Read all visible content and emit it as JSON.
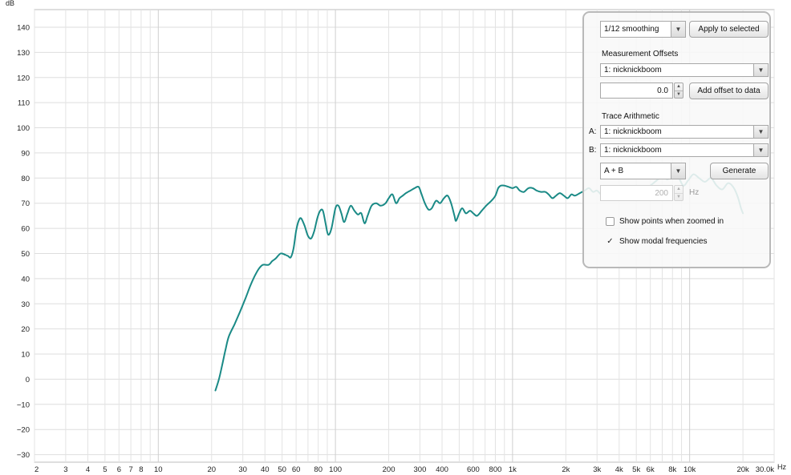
{
  "chart_data": {
    "type": "line",
    "ylabel": "dB",
    "xunit": "Hz",
    "xscale": "log",
    "xlim": [
      2,
      30000
    ],
    "ylim": [
      -33,
      147
    ],
    "y_ticks": [
      140,
      130,
      120,
      110,
      100,
      90,
      80,
      70,
      60,
      50,
      40,
      30,
      20,
      10,
      0,
      -10,
      -20,
      -30
    ],
    "x_tick_labels": [
      {
        "v": 2,
        "label": "2"
      },
      {
        "v": 3,
        "label": "3"
      },
      {
        "v": 4,
        "label": "4"
      },
      {
        "v": 5,
        "label": "5"
      },
      {
        "v": 6,
        "label": "6"
      },
      {
        "v": 7,
        "label": "7"
      },
      {
        "v": 8,
        "label": "8"
      },
      {
        "v": 10,
        "label": "10"
      },
      {
        "v": 20,
        "label": "20"
      },
      {
        "v": 30,
        "label": "30"
      },
      {
        "v": 40,
        "label": "40"
      },
      {
        "v": 50,
        "label": "50"
      },
      {
        "v": 60,
        "label": "60"
      },
      {
        "v": 80,
        "label": "80"
      },
      {
        "v": 100,
        "label": "100"
      },
      {
        "v": 200,
        "label": "200"
      },
      {
        "v": 300,
        "label": "300"
      },
      {
        "v": 400,
        "label": "400"
      },
      {
        "v": 600,
        "label": "600"
      },
      {
        "v": 800,
        "label": "800"
      },
      {
        "v": 1000,
        "label": "1k"
      },
      {
        "v": 2000,
        "label": "2k"
      },
      {
        "v": 3000,
        "label": "3k"
      },
      {
        "v": 4000,
        "label": "4k"
      },
      {
        "v": 5000,
        "label": "5k"
      },
      {
        "v": 6000,
        "label": "6k"
      },
      {
        "v": 8000,
        "label": "8k"
      },
      {
        "v": 10000,
        "label": "10k"
      },
      {
        "v": 20000,
        "label": "20k"
      },
      {
        "v": 30000,
        "label": "30.0k"
      }
    ],
    "grid": true,
    "series": [
      {
        "color": "#1a8a86",
        "points": [
          [
            21,
            -4.5
          ],
          [
            22,
            0
          ],
          [
            23,
            6
          ],
          [
            24,
            12
          ],
          [
            25,
            17
          ],
          [
            27,
            22
          ],
          [
            29,
            27
          ],
          [
            31,
            32
          ],
          [
            33,
            37
          ],
          [
            35,
            41
          ],
          [
            37,
            44
          ],
          [
            39,
            45.5
          ],
          [
            42,
            45.5
          ],
          [
            44,
            47
          ],
          [
            46,
            48
          ],
          [
            49,
            50
          ],
          [
            52,
            49.5
          ],
          [
            54,
            49
          ],
          [
            56,
            48.5
          ],
          [
            58,
            52
          ],
          [
            60,
            59
          ],
          [
            62,
            63
          ],
          [
            64,
            64
          ],
          [
            67,
            61
          ],
          [
            70,
            57
          ],
          [
            73,
            56
          ],
          [
            76,
            59
          ],
          [
            79,
            64
          ],
          [
            82,
            67
          ],
          [
            85,
            67
          ],
          [
            88,
            62
          ],
          [
            91,
            57.5
          ],
          [
            95,
            60
          ],
          [
            100,
            68
          ],
          [
            104,
            69
          ],
          [
            108,
            66
          ],
          [
            112,
            62.5
          ],
          [
            117,
            66
          ],
          [
            122,
            69
          ],
          [
            128,
            67
          ],
          [
            134,
            65.5
          ],
          [
            140,
            66
          ],
          [
            146,
            62
          ],
          [
            152,
            65
          ],
          [
            160,
            69
          ],
          [
            170,
            70
          ],
          [
            180,
            69
          ],
          [
            192,
            70
          ],
          [
            200,
            72
          ],
          [
            210,
            73.5
          ],
          [
            220,
            70
          ],
          [
            230,
            72
          ],
          [
            240,
            73
          ],
          [
            250,
            74
          ],
          [
            265,
            75
          ],
          [
            280,
            76
          ],
          [
            295,
            76.5
          ],
          [
            305,
            74
          ],
          [
            320,
            70
          ],
          [
            335,
            67.5
          ],
          [
            350,
            68
          ],
          [
            370,
            71
          ],
          [
            390,
            70
          ],
          [
            410,
            72
          ],
          [
            430,
            73
          ],
          [
            450,
            70
          ],
          [
            470,
            65
          ],
          [
            480,
            63
          ],
          [
            500,
            66
          ],
          [
            520,
            68
          ],
          [
            545,
            66
          ],
          [
            575,
            67
          ],
          [
            600,
            66
          ],
          [
            630,
            65
          ],
          [
            670,
            67
          ],
          [
            710,
            69
          ],
          [
            760,
            71
          ],
          [
            800,
            73
          ],
          [
            830,
            76
          ],
          [
            860,
            77
          ],
          [
            900,
            77
          ],
          [
            950,
            76.5
          ],
          [
            1000,
            76
          ],
          [
            1050,
            76.5
          ],
          [
            1100,
            75
          ],
          [
            1160,
            74.5
          ],
          [
            1230,
            76
          ],
          [
            1300,
            76
          ],
          [
            1370,
            75
          ],
          [
            1450,
            74.5
          ],
          [
            1530,
            74.5
          ],
          [
            1600,
            73.5
          ],
          [
            1680,
            72
          ],
          [
            1760,
            73
          ],
          [
            1850,
            74
          ],
          [
            1950,
            73
          ],
          [
            2050,
            72
          ],
          [
            2150,
            73.5
          ],
          [
            2250,
            73
          ],
          [
            2400,
            74
          ],
          [
            2550,
            75
          ],
          [
            2700,
            76
          ],
          [
            2850,
            74.5
          ],
          [
            3000,
            75
          ],
          [
            3200,
            73
          ],
          [
            3400,
            72
          ],
          [
            3600,
            73
          ],
          [
            3800,
            72.5
          ],
          [
            4000,
            74
          ],
          [
            4300,
            73.5
          ],
          [
            4600,
            75
          ],
          [
            5000,
            77
          ],
          [
            5500,
            75
          ],
          [
            6000,
            77
          ],
          [
            6500,
            79
          ],
          [
            7000,
            80.5
          ],
          [
            7500,
            79.5
          ],
          [
            8000,
            81
          ],
          [
            8600,
            80.5
          ],
          [
            9200,
            77
          ],
          [
            9800,
            79
          ],
          [
            10500,
            81.5
          ],
          [
            11300,
            80
          ],
          [
            12200,
            78.5
          ],
          [
            13200,
            80
          ],
          [
            14200,
            77
          ],
          [
            15300,
            75.5
          ],
          [
            16500,
            78
          ],
          [
            17800,
            76
          ],
          [
            18800,
            72
          ],
          [
            19500,
            68
          ],
          [
            20000,
            66
          ]
        ]
      }
    ]
  },
  "panel": {
    "smoothing": {
      "value": "1/12 smoothing"
    },
    "apply_button": "Apply to selected",
    "offsets_heading": "Measurement Offsets",
    "offset_measurement": "1: nicknickboom",
    "offset_value": "0.0",
    "add_offset_button": "Add offset to data",
    "trace_heading": "Trace Arithmetic",
    "a_label": "A:",
    "a_value": "1: nicknickboom",
    "b_label": "B:",
    "b_value": "1: nicknickboom",
    "operation": "A + B",
    "generate_button": "Generate",
    "freq_value": "200",
    "freq_unit": "Hz",
    "show_points_label": "Show points when zoomed in",
    "show_points_checked": false,
    "show_modal_label": "Show modal frequencies",
    "show_modal_checked": true
  },
  "checkmark": "✓"
}
